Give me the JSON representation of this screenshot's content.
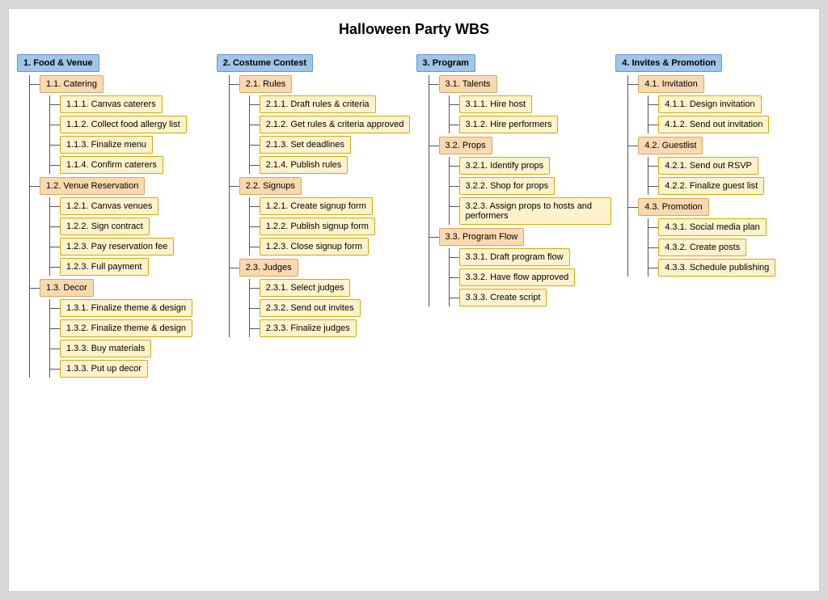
{
  "title": "Halloween Party WBS",
  "columns": [
    {
      "id": "col1",
      "root": {
        "label": "1. Food & Venue"
      },
      "sections": [
        {
          "l2": {
            "label": "1.1. Catering"
          },
          "l3": [
            {
              "label": "1.1.1. Canvas caterers"
            },
            {
              "label": "1.1.2. Collect food allergy list"
            },
            {
              "label": "1.1.3. Finalize menu"
            },
            {
              "label": "1.1.4. Confirm caterers"
            }
          ]
        },
        {
          "l2": {
            "label": "1.2. Venue Reservation"
          },
          "l3": [
            {
              "label": "1.2.1. Canvas venues"
            },
            {
              "label": "1.2.2. Sign contract"
            },
            {
              "label": "1.2.3. Pay reservation fee"
            },
            {
              "label": "1.2.3. Full payment"
            }
          ]
        },
        {
          "l2": {
            "label": "1.3. Decor"
          },
          "l3": [
            {
              "label": "1.3.1. Finalize theme & design"
            },
            {
              "label": "1.3.2. Finalize theme & design"
            },
            {
              "label": "1.3.3. Buy materials"
            },
            {
              "label": "1.3.3. Put up decor"
            }
          ]
        }
      ]
    },
    {
      "id": "col2",
      "root": {
        "label": "2. Costume Contest"
      },
      "sections": [
        {
          "l2": {
            "label": "2.1. Rules"
          },
          "l3": [
            {
              "label": "2.1.1. Draft rules & criteria"
            },
            {
              "label": "2.1.2. Get rules & criteria approved"
            },
            {
              "label": "2.1.3. Set deadlines"
            },
            {
              "label": "2.1.4. Publish rules"
            }
          ]
        },
        {
          "l2": {
            "label": "2.2. Signups"
          },
          "l3": [
            {
              "label": "1.2.1. Create signup form"
            },
            {
              "label": "1.2.2. Publish signup form"
            },
            {
              "label": "1.2.3. Close signup form"
            }
          ]
        },
        {
          "l2": {
            "label": "2.3. Judges"
          },
          "l3": [
            {
              "label": "2.3.1. Select judges"
            },
            {
              "label": "2.3.2. Send out invites"
            },
            {
              "label": "2.3.3. Finalize judges"
            }
          ]
        }
      ]
    },
    {
      "id": "col3",
      "root": {
        "label": "3. Program"
      },
      "sections": [
        {
          "l2": {
            "label": "3.1. Talents"
          },
          "l3": [
            {
              "label": "3.1.1. Hire host"
            },
            {
              "label": "3.1.2. Hire performers"
            }
          ]
        },
        {
          "l2": {
            "label": "3.2. Props"
          },
          "l3": [
            {
              "label": "3.2.1. Identify props"
            },
            {
              "label": "3.2.2. Shop for props"
            },
            {
              "label": "3.2.3. Assign props to hosts and performers"
            }
          ]
        },
        {
          "l2": {
            "label": "3.3. Program Flow"
          },
          "l3": [
            {
              "label": "3.3.1. Draft program flow"
            },
            {
              "label": "3.3.2. Have flow approved"
            },
            {
              "label": "3.3.3. Create script"
            }
          ]
        }
      ]
    },
    {
      "id": "col4",
      "root": {
        "label": "4. Invites & Promotion"
      },
      "sections": [
        {
          "l2": {
            "label": "4.1. Invitation"
          },
          "l3": [
            {
              "label": "4.1.1. Design invitation"
            },
            {
              "label": "4.1.2. Send out invitation"
            }
          ]
        },
        {
          "l2": {
            "label": "4.2. Guestlist"
          },
          "l3": [
            {
              "label": "4.2.1. Send out RSVP"
            },
            {
              "label": "4.2.2. Finalize guest list"
            }
          ]
        },
        {
          "l2": {
            "label": "4.3. Promotion"
          },
          "l3": [
            {
              "label": "4.3.1. Social media plan"
            },
            {
              "label": "4.3.2. Create posts"
            },
            {
              "label": "4.3.3. Schedule publishing"
            }
          ]
        }
      ]
    }
  ]
}
